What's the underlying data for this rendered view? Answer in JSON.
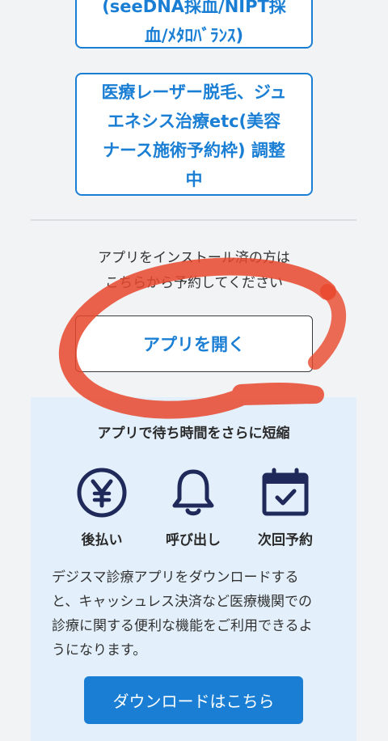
{
  "menu": {
    "card_top_line1": "(seeDNA採血/NIPT採",
    "card_top_line2": "血/ﾒﾀﾛﾊﾞﾗﾝｽ)",
    "card_main_line1": "医療レーザー脱毛、ジュ",
    "card_main_line2": "エネシス治療etc(美容",
    "card_main_line3": "ナース施術予約枠) 調整",
    "card_main_line4": "中"
  },
  "install": {
    "note_line1": "アプリをインストール済の方は",
    "note_line2": "こちらから予約してください",
    "open_app_label": "アプリを開く"
  },
  "promo": {
    "title": "アプリで待ち時間をさらに短縮",
    "features": [
      {
        "label": "後払い",
        "icon": "yen-icon"
      },
      {
        "label": "呼び出し",
        "icon": "bell-icon"
      },
      {
        "label": "次回予約",
        "icon": "calendar-check-icon"
      }
    ],
    "desc_line1": "デジスマ診療アプリをダウンロードする",
    "desc_line2": "と、キャッシュレス決済など医療機関での",
    "desc_line3": "診療に関する便利な機能をご利用できるよ",
    "desc_line4": "うになります。",
    "download_label": "ダウンロードはこちら"
  },
  "colors": {
    "accent": "#1a7fd4",
    "icon_navy": "#1f2a5a",
    "promo_bg": "#e3f0fb",
    "scribble": "#e8472c"
  }
}
